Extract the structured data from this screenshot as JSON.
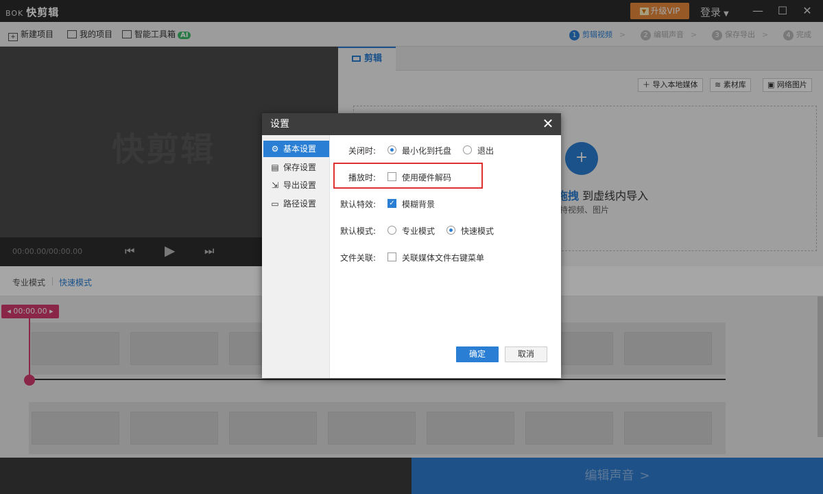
{
  "app": {
    "logo_mark": "BOK",
    "title": "快剪辑",
    "vip_label": "升级VIP",
    "login_label": "登录"
  },
  "toolbar": {
    "new_project": "新建项目",
    "my_projects": "我的项目",
    "smart_tools": "智能工具箱",
    "ai_badge": "AI",
    "steps": [
      {
        "num": "1",
        "label": "剪辑视频"
      },
      {
        "num": "2",
        "label": "编辑声音"
      },
      {
        "num": "3",
        "label": "保存导出"
      },
      {
        "num": "4",
        "label": "完成"
      }
    ]
  },
  "preview": {
    "watermark": "快剪辑",
    "timecode": "00:00.00/00:00.00"
  },
  "right_panel": {
    "tab_label": "剪辑",
    "import_local": "导入本地媒体",
    "library": "素材库",
    "web_images": "网络图片",
    "drop_highlight": "拖拽",
    "drop_title": "到虚线内导入",
    "drop_subtitle": "持视频、图片"
  },
  "modes": {
    "pro": "专业模式",
    "fast": "快速模式"
  },
  "timeline": {
    "playhead_time": "00:00.00"
  },
  "footer": {
    "next_label": "编辑声音"
  },
  "dialog": {
    "title": "设置",
    "sidebar": [
      {
        "label": "基本设置",
        "icon": "gear-icon"
      },
      {
        "label": "保存设置",
        "icon": "save-icon"
      },
      {
        "label": "导出设置",
        "icon": "export-icon"
      },
      {
        "label": "路径设置",
        "icon": "folder-icon"
      }
    ],
    "close_label": "关闭时:",
    "close_minimize": "最小化到托盘",
    "close_exit": "退出",
    "play_label": "播放时:",
    "play_hw_decode": "使用硬件解码",
    "effect_label": "默认特效:",
    "effect_blur_bg": "模糊背景",
    "mode_label": "默认模式:",
    "mode_pro": "专业模式",
    "mode_fast": "快速模式",
    "assoc_label": "文件关联:",
    "assoc_context_menu": "关联媒体文件右键菜单",
    "ok_label": "确定",
    "cancel_label": "取消"
  },
  "colors": {
    "accent": "#2a7fd4",
    "vip": "#e8893a",
    "playhead": "#d43b6d",
    "highlight_box": "#e03030"
  }
}
